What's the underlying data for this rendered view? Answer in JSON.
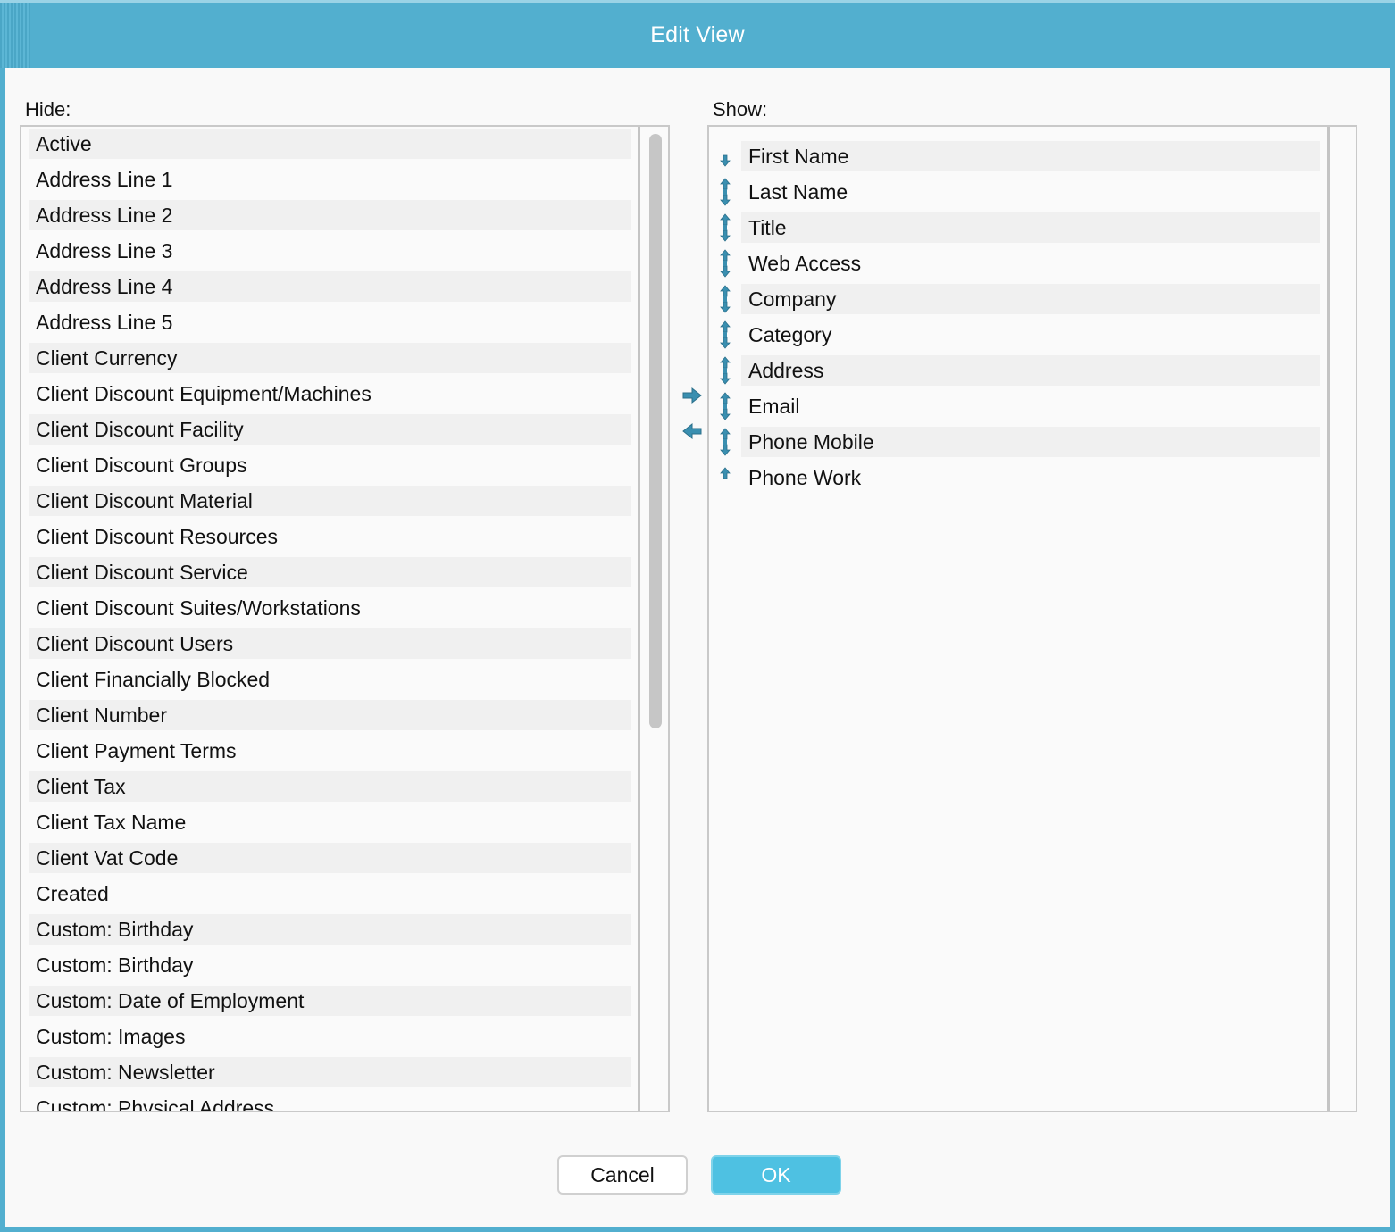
{
  "dialog": {
    "title": "Edit View"
  },
  "hide": {
    "label": "Hide:",
    "items": [
      "Active",
      "Address Line 1",
      "Address Line 2",
      "Address Line 3",
      "Address Line 4",
      "Address Line 5",
      "Client Currency",
      "Client Discount Equipment/Machines",
      "Client Discount Facility",
      "Client Discount Groups",
      "Client Discount Material",
      "Client Discount Resources",
      "Client Discount Service",
      "Client Discount Suites/Workstations",
      "Client Discount Users",
      "Client Financially Blocked",
      "Client Number",
      "Client Payment Terms",
      "Client Tax",
      "Client Tax Name",
      "Client Vat Code",
      "Created",
      "Custom: Birthday",
      "Custom: Birthday",
      "Custom: Date of Employment",
      "Custom: Images",
      "Custom: Newsletter",
      "Custom: Physical Address"
    ]
  },
  "show": {
    "label": "Show:",
    "items": [
      "First Name",
      "Last Name",
      "Title",
      "Web Access",
      "Company",
      "Category",
      "Address",
      "Email",
      "Phone Mobile",
      "Phone Work"
    ]
  },
  "icons": {
    "move_right": "arrow-right-icon",
    "move_left": "arrow-left-icon",
    "reorder": "reorder-arrows-icon"
  },
  "colors": {
    "accent": "#52afcf",
    "ok": "#4ec1e2",
    "icon": "#3a8fb0"
  },
  "buttons": {
    "cancel": "Cancel",
    "ok": "OK"
  }
}
